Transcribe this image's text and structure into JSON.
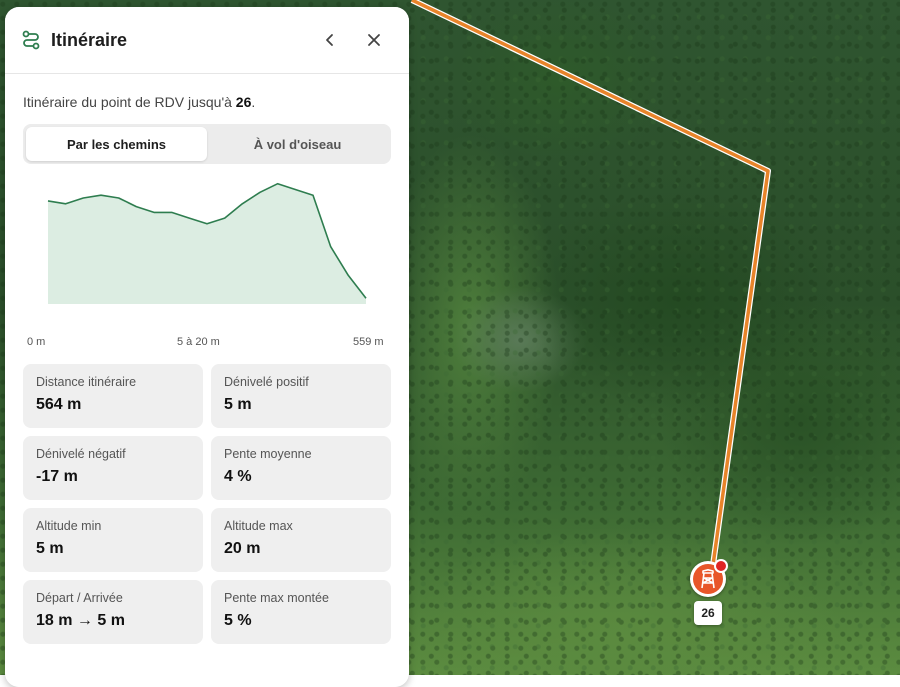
{
  "panel": {
    "title": "Itinéraire",
    "intro_prefix": "Itinéraire du point de RDV jusqu'à ",
    "intro_target": "26",
    "intro_suffix": ".",
    "tabs": [
      {
        "label": "Par les chemins",
        "active": true
      },
      {
        "label": "À vol d'oiseau",
        "active": false
      }
    ]
  },
  "chart_data": {
    "type": "area",
    "x_tick_labels": [
      "0 m",
      "5 à 20 m",
      "559 m"
    ],
    "y": [
      18,
      17.5,
      18.5,
      19,
      18.5,
      17,
      16,
      16,
      15,
      14,
      15,
      17.5,
      19.5,
      21,
      20,
      19,
      10,
      5,
      1
    ],
    "color": "#2e7d4f",
    "fill": "#dcede2"
  },
  "stats": [
    {
      "label": "Distance itinéraire",
      "value": "564 m"
    },
    {
      "label": "Dénivelé positif",
      "value": "5 m"
    },
    {
      "label": "Dénivelé négatif",
      "value": "-17 m"
    },
    {
      "label": "Pente moyenne",
      "value": "4 %"
    },
    {
      "label": "Altitude min",
      "value": "5 m"
    },
    {
      "label": "Altitude max",
      "value": "20 m"
    },
    {
      "label": "Départ / Arrivée",
      "value": "18 m → 5 m"
    },
    {
      "label": "Pente max montée",
      "value": "5 %"
    }
  ],
  "map": {
    "marker_label": "26",
    "route_color": "#e8842a",
    "marker_color": "#e8562a"
  }
}
